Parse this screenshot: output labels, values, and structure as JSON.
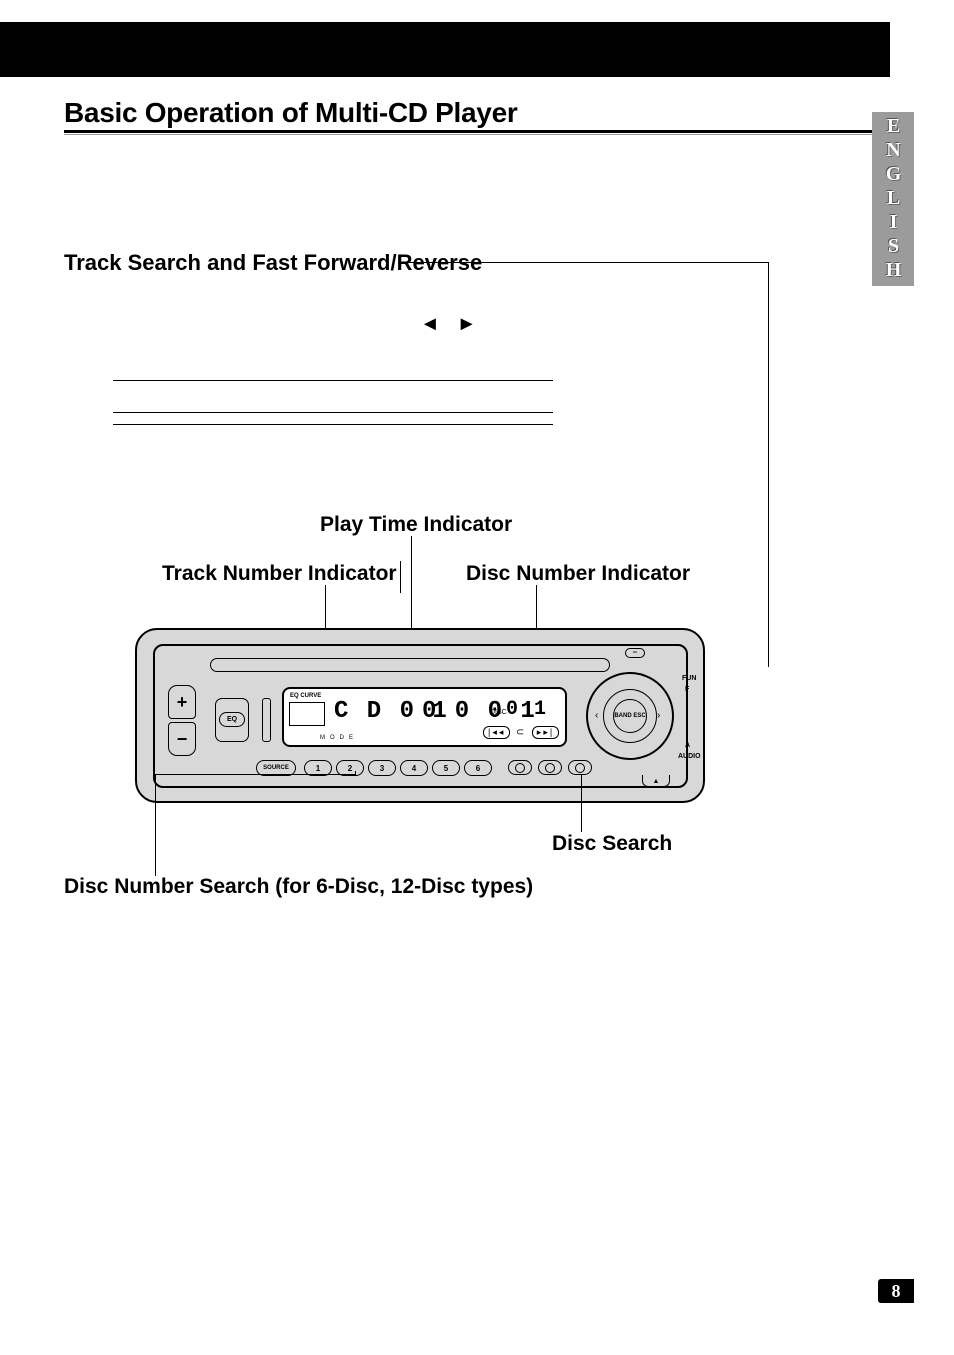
{
  "page_number": "8",
  "language_tab": "ENGLISH",
  "title": "Basic Operation of Multi-CD Player",
  "labels": {
    "track_search": "Track Search and Fast Forward/Reverse",
    "play_time": "Play Time Indicator",
    "track_number": "Track Number Indicator",
    "disc_number": "Disc Number Indicator",
    "disc_search": "Disc Search",
    "disc_number_search": "Disc Number Search (for 6-Disc, 12-Disc types)"
  },
  "arrows": "◄ ►",
  "device": {
    "vol_plus": "+",
    "vol_minus": "−",
    "eq_label": "EQ",
    "eq_curve": "EQ CURVE",
    "mode": "MODE",
    "source": "SOURCE",
    "numbers": [
      "1",
      "2",
      "3",
      "4",
      "5",
      "6"
    ],
    "lcd": {
      "cd_text": "C D 0  1",
      "time_text": "0 0 0 1",
      "disc_label": "DISC",
      "disc_text": "0 1"
    },
    "skip": {
      "prev": "|◂◂",
      "loop": "⊂",
      "next": "▸▸|"
    },
    "knob": {
      "center": "BAND\nESC",
      "left": "‹",
      "right": "›",
      "fun": "FUN",
      "f": "F",
      "a": "A",
      "audio": "AUDIO"
    },
    "detach": "▲"
  }
}
